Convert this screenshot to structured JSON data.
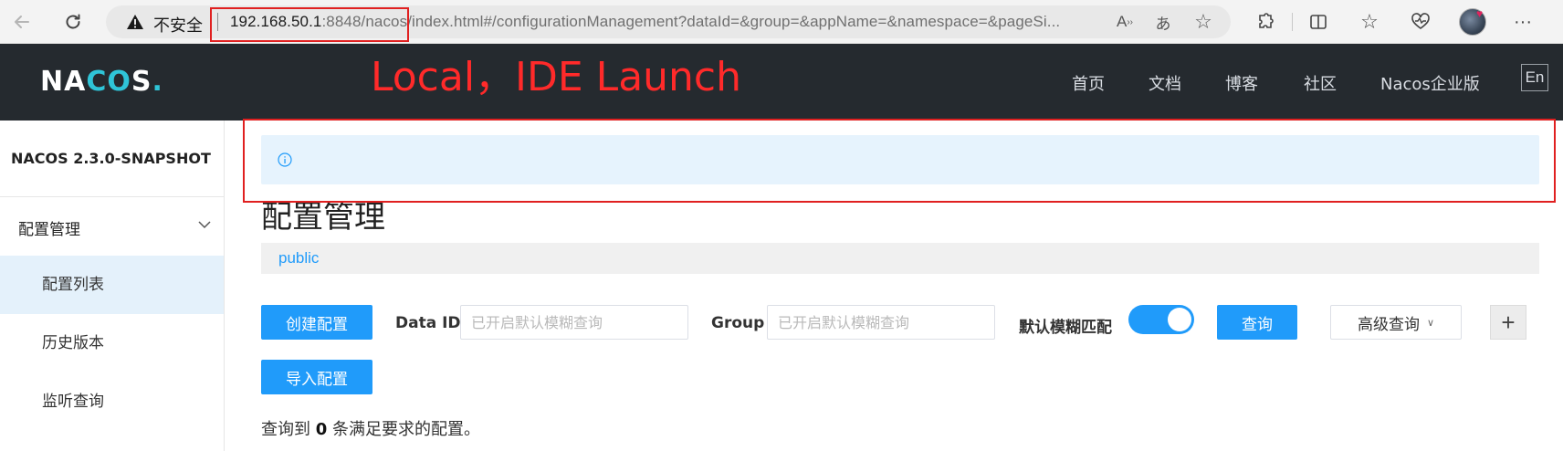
{
  "browser": {
    "insecure_label": "不安全",
    "url_host": "192.168.50.1",
    "url_rest": ":8848/nacos/index.html#/configurationManagement?dataId=&group=&appName=&namespace=&pageSi...",
    "icons": [
      "back-icon",
      "refresh-icon",
      "warning-icon",
      "read-aloud-icon",
      "translate-icon",
      "favorite-star-icon",
      "extensions-icon",
      "split-screen-icon",
      "favorites-icon",
      "health-icon",
      "profile-avatar",
      "more-icon"
    ]
  },
  "annotation": {
    "text": "Local，IDE Launch",
    "color": "#e02020"
  },
  "header": {
    "logo_left": "NA",
    "logo_accent": "CO",
    "logo_right": "S",
    "logo_dot": ".",
    "nav": [
      "首页",
      "文档",
      "博客",
      "社区",
      "Nacos企业版"
    ],
    "lang": "En"
  },
  "sidebar": {
    "version": "NACOS 2.3.0-SNAPSHOT",
    "group_label": "配置管理",
    "items": [
      {
        "label": "配置列表",
        "active": true
      },
      {
        "label": "历史版本",
        "active": false
      },
      {
        "label": "监听查询",
        "active": false
      }
    ]
  },
  "main": {
    "title": "配置管理",
    "namespace": "public",
    "create_button": "创建配置",
    "import_button": "导入配置",
    "data_id_label": "Data ID",
    "data_id_placeholder": "已开启默认模糊查询",
    "group_label": "Group",
    "group_placeholder": "已开启默认模糊查询",
    "fuzzy_label": "默认模糊匹配",
    "fuzzy_enabled": true,
    "query_button": "查询",
    "advanced_button": "高级查询",
    "plus_button": "+",
    "result_prefix": "查询到",
    "result_count": "0",
    "result_suffix": "条满足要求的配置。"
  },
  "colors": {
    "primary": "#209bfa",
    "header_bg": "#252a2f",
    "notice_bg": "#e6f3fd",
    "active_item_bg": "#e4f1fb"
  }
}
